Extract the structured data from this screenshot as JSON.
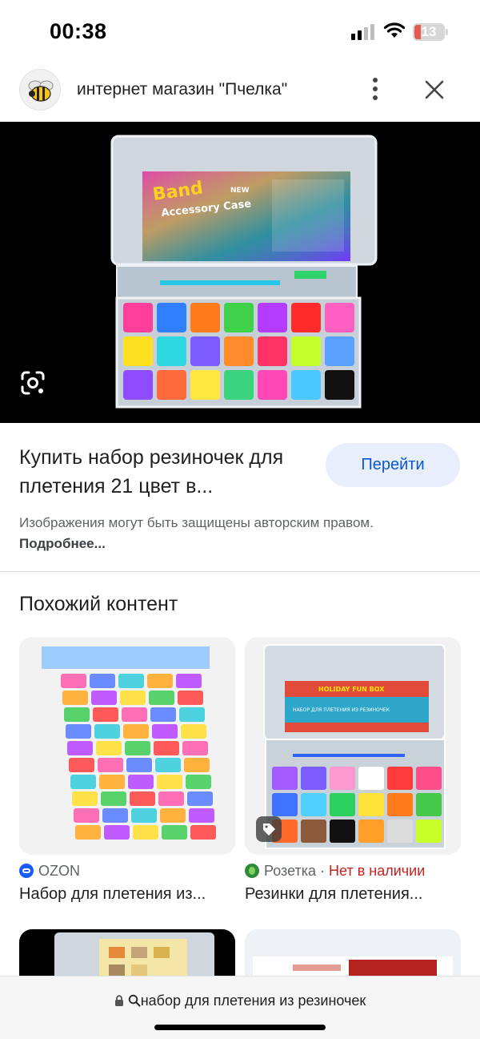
{
  "status_bar": {
    "time": "00:38",
    "battery": "13"
  },
  "header": {
    "site_name": "интернет магазин \"Пчелка\""
  },
  "main_image": {
    "texts": [
      "Band",
      "NEW",
      "Accessory Case"
    ],
    "compartment_colors": [
      "#ff3f9a",
      "#2f7fff",
      "#ff7a1a",
      "#3fd14a",
      "#b33cff",
      "#ff2b2b",
      "#ff5fc0",
      "#ffe020",
      "#2fd8e0",
      "#7a5cff",
      "#ff8c2a",
      "#ff3366",
      "#c3ff2a",
      "#5aa0ff",
      "#8f4cff",
      "#ff6a3c",
      "#ffe640",
      "#3ad37e",
      "#ff48b5",
      "#4bc8ff",
      "#111111"
    ]
  },
  "result": {
    "title": "Купить набор резиночек для плетения 21 цвет в...",
    "visit_label": "Перейти",
    "copyright_text": "Изображения могут быть защищены авторским правом.",
    "more_link": "Подробнее..."
  },
  "similar": {
    "heading": "Похожий контент",
    "cards": [
      {
        "source": "OZON",
        "title": "Набор для плетения из..."
      },
      {
        "source": "Розетка",
        "separator": "·",
        "availability": "Нет в наличии",
        "title": "Резинки для плетения...",
        "box_texts": [
          "HOLIDAY FUN BOX",
          "НАБОР ДЛЯ ПЛЕТЕНИЯ ИЗ РЕЗИНОЧЕК"
        ]
      }
    ]
  },
  "bottom_bar": {
    "url_text": "набор для плетения из резиночек"
  },
  "colors": {
    "accent": "#0b57d0",
    "button_bg": "#e8eefb",
    "unavailable": "#c5221f",
    "ozon": "#1a5bff",
    "rozetka": "#2e8b3a"
  }
}
